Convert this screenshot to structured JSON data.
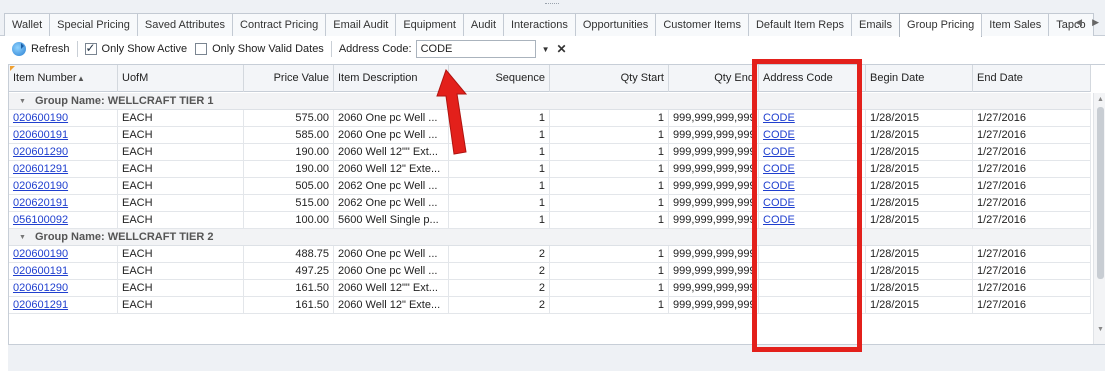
{
  "tabs": [
    "Wallet",
    "Special Pricing",
    "Saved Attributes",
    "Contract Pricing",
    "Email Audit",
    "Equipment",
    "Audit",
    "Interactions",
    "Opportunities",
    "Customer Items",
    "Default Item Reps",
    "Emails",
    "Group Pricing",
    "Item Sales",
    "Tapco"
  ],
  "active_tab": "Group Pricing",
  "toolbar": {
    "refresh_label": "Refresh",
    "only_active_label": "Only Show Active",
    "only_active_checked": true,
    "only_valid_label": "Only Show Valid Dates",
    "only_valid_checked": false,
    "address_code_label": "Address Code:",
    "address_code_value": "CODE"
  },
  "columns": [
    "Item Number",
    "UofM",
    "Price Value",
    "Item Description",
    "Sequence",
    "Qty Start",
    "Qty End",
    "Address Code",
    "Begin Date",
    "End Date"
  ],
  "groups": [
    {
      "label": "Group Name: WELLCRAFT TIER 1",
      "rows": [
        {
          "item": "020600190",
          "uofm": "EACH",
          "price": "575.00",
          "desc": "2060 One pc Well ...",
          "seq": "1",
          "qty_start": "1",
          "qty_end": "999,999,999,999",
          "addr": "CODE",
          "begin": "1/28/2015",
          "end": "1/27/2016"
        },
        {
          "item": "020600191",
          "uofm": "EACH",
          "price": "585.00",
          "desc": "2060 One pc Well ...",
          "seq": "1",
          "qty_start": "1",
          "qty_end": "999,999,999,999",
          "addr": "CODE",
          "begin": "1/28/2015",
          "end": "1/27/2016"
        },
        {
          "item": "020601290",
          "uofm": "EACH",
          "price": "190.00",
          "desc": "2060 Well 12\"\" Ext...",
          "seq": "1",
          "qty_start": "1",
          "qty_end": "999,999,999,999",
          "addr": "CODE",
          "begin": "1/28/2015",
          "end": "1/27/2016"
        },
        {
          "item": "020601291",
          "uofm": "EACH",
          "price": "190.00",
          "desc": "2060 Well 12\" Exte...",
          "seq": "1",
          "qty_start": "1",
          "qty_end": "999,999,999,999",
          "addr": "CODE",
          "begin": "1/28/2015",
          "end": "1/27/2016"
        },
        {
          "item": "020620190",
          "uofm": "EACH",
          "price": "505.00",
          "desc": "2062 One pc Well ...",
          "seq": "1",
          "qty_start": "1",
          "qty_end": "999,999,999,999",
          "addr": "CODE",
          "begin": "1/28/2015",
          "end": "1/27/2016"
        },
        {
          "item": "020620191",
          "uofm": "EACH",
          "price": "515.00",
          "desc": "2062 One pc Well ...",
          "seq": "1",
          "qty_start": "1",
          "qty_end": "999,999,999,999",
          "addr": "CODE",
          "begin": "1/28/2015",
          "end": "1/27/2016"
        },
        {
          "item": "056100092",
          "uofm": "EACH",
          "price": "100.00",
          "desc": "5600 Well Single p...",
          "seq": "1",
          "qty_start": "1",
          "qty_end": "999,999,999,999",
          "addr": "CODE",
          "begin": "1/28/2015",
          "end": "1/27/2016"
        }
      ]
    },
    {
      "label": "Group Name: WELLCRAFT TIER 2",
      "rows": [
        {
          "item": "020600190",
          "uofm": "EACH",
          "price": "488.75",
          "desc": "2060 One pc Well ...",
          "seq": "2",
          "qty_start": "1",
          "qty_end": "999,999,999,999",
          "addr": "",
          "begin": "1/28/2015",
          "end": "1/27/2016"
        },
        {
          "item": "020600191",
          "uofm": "EACH",
          "price": "497.25",
          "desc": "2060 One pc Well ...",
          "seq": "2",
          "qty_start": "1",
          "qty_end": "999,999,999,999",
          "addr": "",
          "begin": "1/28/2015",
          "end": "1/27/2016"
        },
        {
          "item": "020601290",
          "uofm": "EACH",
          "price": "161.50",
          "desc": "2060 Well 12\"\" Ext...",
          "seq": "2",
          "qty_start": "1",
          "qty_end": "999,999,999,999",
          "addr": "",
          "begin": "1/28/2015",
          "end": "1/27/2016"
        },
        {
          "item": "020601291",
          "uofm": "EACH",
          "price": "161.50",
          "desc": "2060 Well 12\" Exte...",
          "seq": "2",
          "qty_start": "1",
          "qty_end": "999,999,999,999",
          "addr": "",
          "begin": "1/28/2015",
          "end": "1/27/2016"
        }
      ]
    }
  ],
  "colors": {
    "highlight": "#e3201b",
    "link": "#1f3fcf"
  }
}
